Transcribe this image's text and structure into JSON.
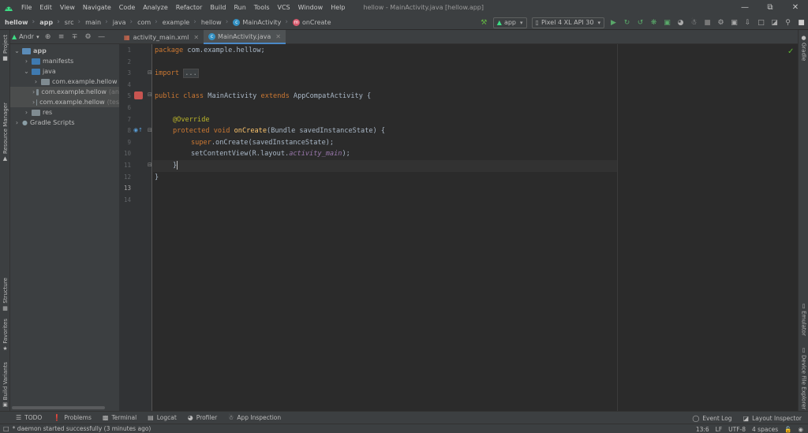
{
  "menubar": {
    "items": [
      "File",
      "Edit",
      "View",
      "Navigate",
      "Code",
      "Analyze",
      "Refactor",
      "Build",
      "Run",
      "Tools",
      "VCS",
      "Window",
      "Help"
    ],
    "window_title": "hellow - MainActivity.java [hellow.app]"
  },
  "breadcrumb": {
    "items": [
      "hellow",
      "app",
      "src",
      "main",
      "java",
      "com",
      "example",
      "hellow",
      "MainActivity",
      "onCreate"
    ]
  },
  "toolbar": {
    "run_config": "app",
    "device": "Pixel 4 XL API 30"
  },
  "project_panel": {
    "view_mode": "Andr",
    "tree": [
      {
        "label": "app",
        "depth": 0,
        "expanded": true,
        "kind": "module"
      },
      {
        "label": "manifests",
        "depth": 1,
        "expanded": false,
        "kind": "folder"
      },
      {
        "label": "java",
        "depth": 1,
        "expanded": true,
        "kind": "folder"
      },
      {
        "label": "com.example.hellow",
        "depth": 2,
        "expanded": false,
        "kind": "package",
        "suffix": ""
      },
      {
        "label": "com.example.hellow",
        "depth": 2,
        "expanded": false,
        "kind": "package",
        "suffix": "(an",
        "selected": true
      },
      {
        "label": "com.example.hellow",
        "depth": 2,
        "expanded": false,
        "kind": "package",
        "suffix": "(tes",
        "selected": true
      },
      {
        "label": "res",
        "depth": 1,
        "expanded": false,
        "kind": "folder"
      },
      {
        "label": "Gradle Scripts",
        "depth": 0,
        "expanded": false,
        "kind": "gradle"
      }
    ]
  },
  "left_tool_tabs": [
    "Project",
    "Resource Manager",
    "Structure",
    "Favorites",
    "Build Variants"
  ],
  "right_tool_tabs": [
    "Gradle",
    "Emulator",
    "Device File Explorer"
  ],
  "editor_tabs": [
    {
      "label": "activity_main.xml",
      "active": false
    },
    {
      "label": "MainActivity.java",
      "active": true
    }
  ],
  "code_lines": [
    "1",
    "2",
    "3",
    "4",
    "5",
    "6",
    "7",
    "8",
    "9",
    "10",
    "11",
    "12",
    "13",
    "14"
  ],
  "code": {
    "l1_kw": "package",
    "l1_rest": " com.example.hellow;",
    "l3_kw": "import",
    "l3_fold": "...",
    "l6_kw1": "public class",
    "l6_name": " MainActivity ",
    "l6_kw2": "extends",
    "l6_rest": " AppCompatActivity {",
    "l9_ann": "@Override",
    "l10_kw": "protected void",
    "l10_fn": "onCreate",
    "l10_rest": "(Bundle savedInstanceState) {",
    "l11_kw": "super",
    "l11_rest": ".onCreate(savedInstanceState);",
    "l12_rest": "setContentView(R.layout.",
    "l12_field": "activity_main",
    "l12_end": ");",
    "l13": "}",
    "l14": "}"
  },
  "bottom_tabs": [
    "TODO",
    "Problems",
    "Terminal",
    "Logcat",
    "Profiler",
    "App Inspection"
  ],
  "bottom_right_tabs": [
    "Event Log",
    "Layout Inspector"
  ],
  "status": {
    "message": "* daemon started successfully (3 minutes ago)",
    "position": "13:6",
    "line_sep": "LF",
    "encoding": "UTF-8",
    "indent": "4 spaces"
  }
}
